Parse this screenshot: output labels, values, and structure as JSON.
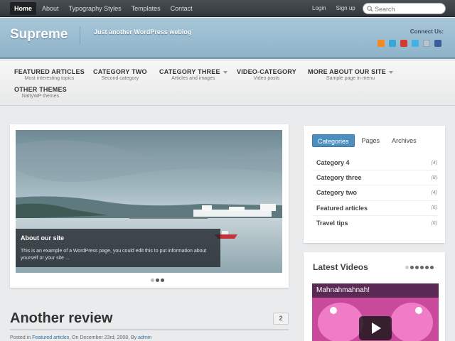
{
  "topbar": {
    "nav": [
      "Home",
      "About",
      "Typography Styles",
      "Templates",
      "Contact"
    ],
    "login": "Login",
    "signup": "Sign up",
    "search_placeholder": "Search"
  },
  "header": {
    "logo": "Supreme",
    "tagline": "Just another WordPress weblog",
    "connect_label": "Connect Us:",
    "social_icons": [
      "rss-icon",
      "vimeo-icon",
      "youtube-icon",
      "twitter-icon",
      "email-icon",
      "facebook-icon"
    ]
  },
  "mainnav": [
    {
      "title": "FEATURED ARTICLES",
      "sub": "Most interesting topics",
      "dropdown": false
    },
    {
      "title": "CATEGORY TWO",
      "sub": "Second category",
      "dropdown": false
    },
    {
      "title": "CATEGORY THREE",
      "sub": "Articles and images",
      "dropdown": true
    },
    {
      "title": "VIDEO-CATEGORY",
      "sub": "Video posts",
      "dropdown": false
    },
    {
      "title": "MORE ABOUT OUR SITE",
      "sub": "Sample page in menu",
      "dropdown": true
    },
    {
      "title": "OTHER THEMES",
      "sub": "NattyWP themes",
      "dropdown": false
    }
  ],
  "slider": {
    "caption_title": "About our site",
    "caption_text": "This is an example of a WordPress page, you could edit this to put information about yourself or your site ...",
    "slides": 3,
    "active_slide": 1
  },
  "post": {
    "title": "Another review",
    "comments": "2",
    "meta_prefix": "Posted in",
    "category": "Featured articles",
    "meta_date": ", On December 23rd, 2008, By",
    "author": "admin"
  },
  "sidebar": {
    "tabs": [
      "Categories",
      "Pages",
      "Archives"
    ],
    "categories": [
      {
        "name": "Category 4",
        "count": "(4)"
      },
      {
        "name": "Category three",
        "count": "(8)"
      },
      {
        "name": "Category two",
        "count": "(4)"
      },
      {
        "name": "Featured articles",
        "count": "(6)"
      },
      {
        "name": "Travel tips",
        "count": "(6)"
      }
    ]
  },
  "videos": {
    "title": "Latest Videos",
    "video_title": "Mahnahmahnah!",
    "pages": 6,
    "active_page": 0
  },
  "colors": {
    "accent": "#4d8ec0",
    "header_bg": "#9dbfd2",
    "topbar_bg": "#3d4146"
  }
}
